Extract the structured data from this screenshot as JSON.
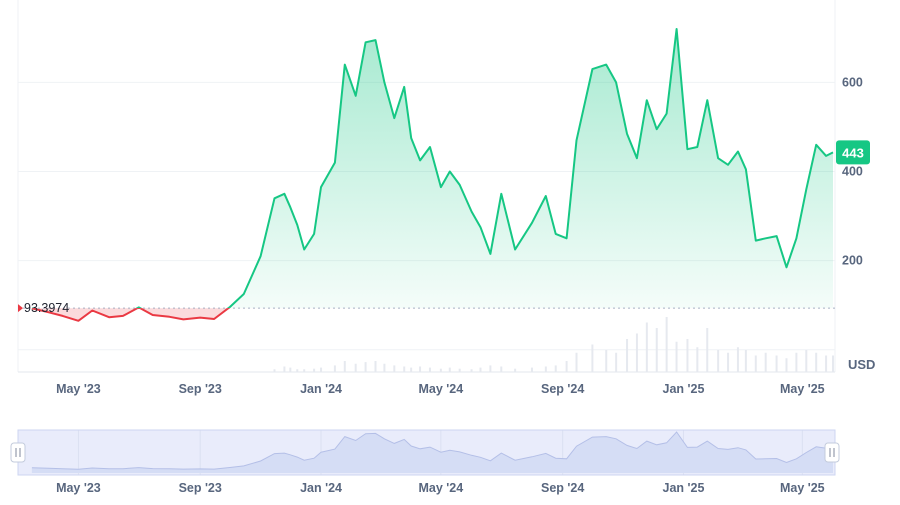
{
  "colors": {
    "up_line": "#16c784",
    "down_line": "#ea3943",
    "grid": "#eff2f5",
    "baseline": "#a6b0c3",
    "badge_bg": "#16c784",
    "volume": "#e6e9ef",
    "nav_fill": "#dde3f7",
    "nav_line": "#b9c3e8"
  },
  "chart_data": {
    "type": "area",
    "x": [
      "2023-03-15",
      "2023-04-01",
      "2023-04-15",
      "2023-05-01",
      "2023-05-15",
      "2023-06-01",
      "2023-06-15",
      "2023-07-01",
      "2023-07-15",
      "2023-08-01",
      "2023-08-15",
      "2023-09-01",
      "2023-09-15",
      "2023-10-01",
      "2023-10-15",
      "2023-11-01",
      "2023-11-15",
      "2023-11-25",
      "2023-12-01",
      "2023-12-08",
      "2023-12-15",
      "2023-12-25",
      "2024-01-01",
      "2024-01-15",
      "2024-01-25",
      "2024-02-05",
      "2024-02-15",
      "2024-02-25",
      "2024-03-05",
      "2024-03-15",
      "2024-03-25",
      "2024-04-01",
      "2024-04-10",
      "2024-04-20",
      "2024-05-01",
      "2024-05-10",
      "2024-05-20",
      "2024-06-01",
      "2024-06-10",
      "2024-06-20",
      "2024-07-01",
      "2024-07-15",
      "2024-08-01",
      "2024-08-15",
      "2024-08-25",
      "2024-09-05",
      "2024-09-15",
      "2024-10-01",
      "2024-10-15",
      "2024-10-25",
      "2024-11-05",
      "2024-11-15",
      "2024-11-25",
      "2024-12-05",
      "2024-12-15",
      "2024-12-25",
      "2025-01-05",
      "2025-01-15",
      "2025-01-25",
      "2025-02-05",
      "2025-02-15",
      "2025-02-25",
      "2025-03-05",
      "2025-03-15",
      "2025-03-25",
      "2025-04-05",
      "2025-04-15",
      "2025-04-25",
      "2025-05-05",
      "2025-05-15",
      "2025-05-25",
      "2025-06-01"
    ],
    "values": [
      93,
      84,
      76,
      65,
      88,
      73,
      76,
      95,
      78,
      74,
      68,
      72,
      69,
      96,
      125,
      210,
      340,
      350,
      320,
      280,
      225,
      260,
      365,
      420,
      640,
      570,
      690,
      695,
      600,
      520,
      590,
      475,
      425,
      455,
      365,
      400,
      370,
      310,
      275,
      215,
      350,
      225,
      285,
      345,
      260,
      250,
      470,
      630,
      640,
      600,
      485,
      430,
      560,
      495,
      530,
      720,
      450,
      455,
      560,
      430,
      415,
      445,
      405,
      245,
      250,
      255,
      185,
      250,
      360,
      460,
      435,
      443
    ],
    "ylim": [
      -50,
      785
    ],
    "xlim": [
      "2023-03-01",
      "2025-06-03"
    ],
    "baseline_value": 93.3974,
    "baseline_label": "93.3974",
    "current_value_label": "443",
    "y_ticks": [
      200,
      400,
      600
    ],
    "y_tick_labels": [
      "200",
      "400",
      "600"
    ],
    "x_tick_dates": [
      "2023-05-01",
      "2023-09-01",
      "2024-01-01",
      "2024-05-01",
      "2024-09-01",
      "2025-01-01",
      "2025-05-01"
    ],
    "x_tick_labels": [
      "May '23",
      "Sep '23",
      "Jan '24",
      "May '24",
      "Sep '24",
      "Jan '25",
      "May '25"
    ],
    "unit_label": "USD",
    "volume_relative": [
      0,
      0,
      0,
      0,
      0,
      0,
      0,
      0,
      0,
      0,
      0,
      0,
      0,
      0,
      0,
      0,
      0.05,
      0.1,
      0.08,
      0.05,
      0.05,
      0.06,
      0.08,
      0.12,
      0.2,
      0.15,
      0.18,
      0.2,
      0.15,
      0.12,
      0.1,
      0.08,
      0.1,
      0.08,
      0.06,
      0.08,
      0.06,
      0.05,
      0.08,
      0.12,
      0.1,
      0.06,
      0.08,
      0.1,
      0.12,
      0.2,
      0.35,
      0.5,
      0.4,
      0.35,
      0.6,
      0.7,
      0.9,
      0.8,
      1.0,
      0.55,
      0.6,
      0.45,
      0.8,
      0.4,
      0.35,
      0.45,
      0.4,
      0.3,
      0.35,
      0.3,
      0.25,
      0.35,
      0.4,
      0.35,
      0.3,
      0.3
    ],
    "grid": true,
    "legend": "none"
  }
}
